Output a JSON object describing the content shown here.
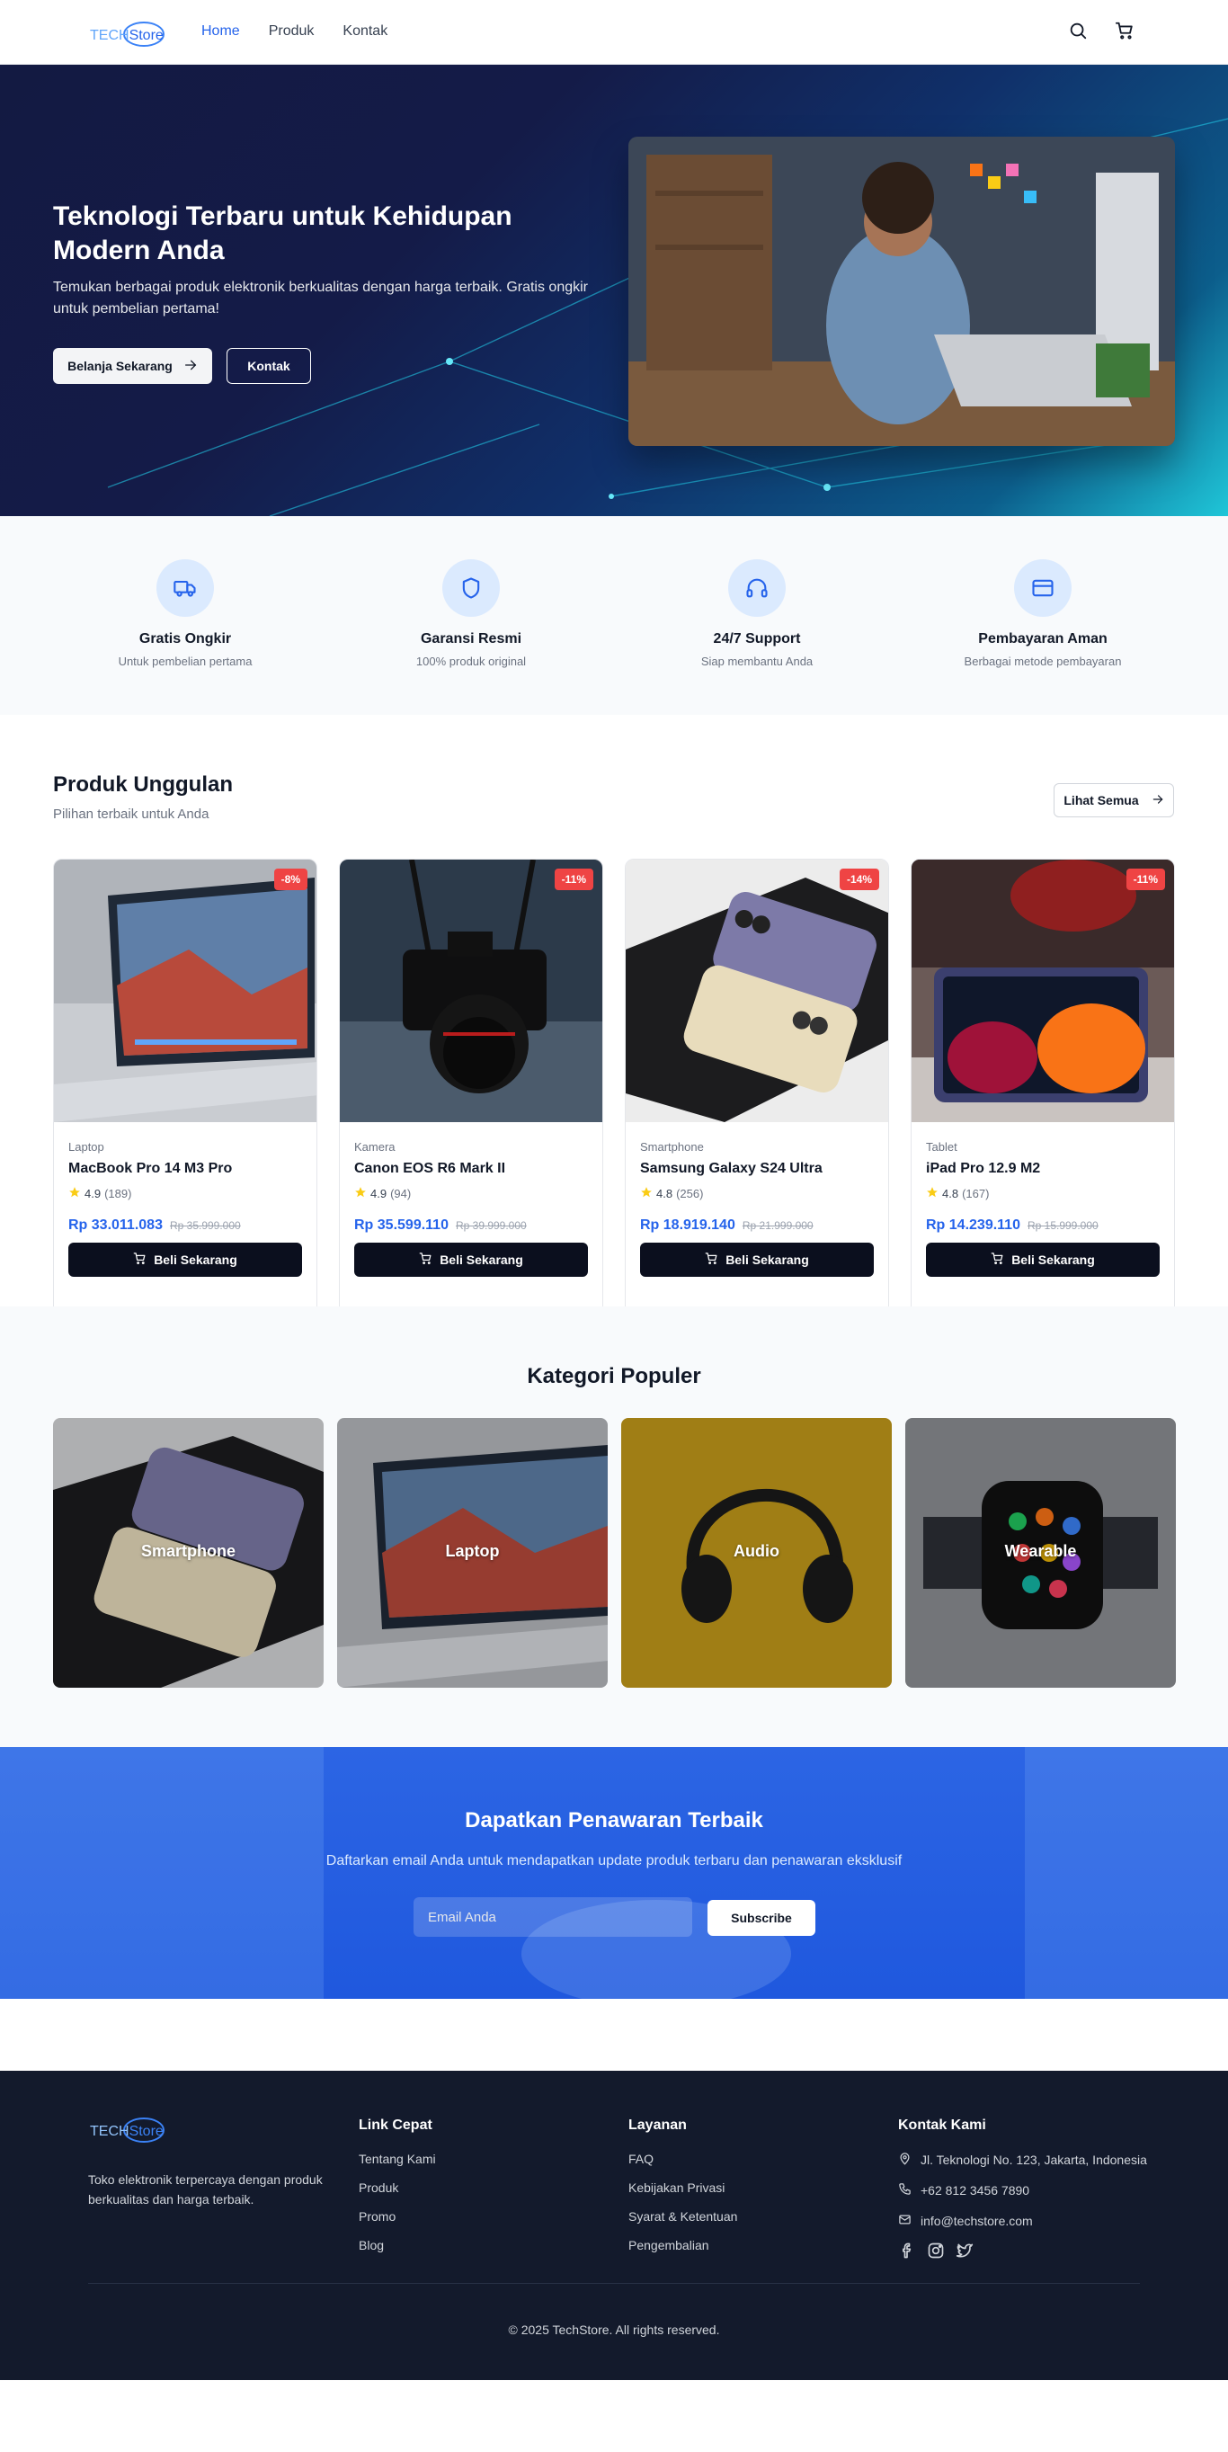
{
  "brand": {
    "name_part1": "TECH",
    "name_part2": "Store"
  },
  "nav": {
    "links": [
      "Home",
      "Produk",
      "Kontak"
    ],
    "icons": [
      "search-icon",
      "cart-icon"
    ]
  },
  "hero": {
    "title": "Teknologi Terbaru untuk Kehidupan Modern Anda",
    "subtitle": "Temukan berbagai produk elektronik berkualitas dengan harga terbaik. Gratis ongkir untuk pembelian pertama!",
    "primary_button": "Belanja Sekarang",
    "secondary_button": "Kontak"
  },
  "features": [
    {
      "icon": "truck-icon",
      "title": "Gratis Ongkir",
      "subtitle": "Untuk pembelian pertama"
    },
    {
      "icon": "shield-icon",
      "title": "Garansi Resmi",
      "subtitle": "100% produk original"
    },
    {
      "icon": "headphones-icon",
      "title": "24/7 Support",
      "subtitle": "Siap membantu Anda"
    },
    {
      "icon": "credit-card-icon",
      "title": "Pembayaran Aman",
      "subtitle": "Berbagai metode pembayaran"
    }
  ],
  "products_section": {
    "title": "Produk Unggulan",
    "subtitle": "Pilihan terbaik untuk Anda",
    "see_all": "Lihat Semua",
    "items": [
      {
        "category": "Laptop",
        "name": "MacBook Pro 14 M3 Pro",
        "rating": "4.9",
        "reviews": "(189)",
        "price": "Rp 33.011.083",
        "old_price": "Rp 35.999.000",
        "discount": "-8%",
        "buy": "Beli Sekarang"
      },
      {
        "category": "Kamera",
        "name": "Canon EOS R6 Mark II",
        "rating": "4.9",
        "reviews": "(94)",
        "price": "Rp 35.599.110",
        "old_price": "Rp 39.999.000",
        "discount": "-11%",
        "buy": "Beli Sekarang"
      },
      {
        "category": "Smartphone",
        "name": "Samsung Galaxy S24 Ultra",
        "rating": "4.8",
        "reviews": "(256)",
        "price": "Rp 18.919.140",
        "old_price": "Rp 21.999.000",
        "discount": "-14%",
        "buy": "Beli Sekarang"
      },
      {
        "category": "Tablet",
        "name": "iPad Pro 12.9 M2",
        "rating": "4.8",
        "reviews": "(167)",
        "price": "Rp 14.239.110",
        "old_price": "Rp 15.999.000",
        "discount": "-11%",
        "buy": "Beli Sekarang"
      }
    ]
  },
  "categories": {
    "title": "Kategori Populer",
    "items": [
      "Smartphone",
      "Laptop",
      "Audio",
      "Wearable"
    ]
  },
  "newsletter": {
    "title": "Dapatkan Penawaran Terbaik",
    "subtitle": "Daftarkan email Anda untuk mendapatkan update produk terbaru dan penawaran eksklusif",
    "placeholder": "Email Anda",
    "button": "Subscribe"
  },
  "footer": {
    "about": "Toko elektronik terpercaya dengan produk berkualitas dan harga terbaik.",
    "quick_links": {
      "title": "Link Cepat",
      "items": [
        "Tentang Kami",
        "Produk",
        "Promo",
        "Blog"
      ]
    },
    "services": {
      "title": "Layanan",
      "items": [
        "FAQ",
        "Kebijakan Privasi",
        "Syarat & Ketentuan",
        "Pengembalian"
      ]
    },
    "contact": {
      "title": "Kontak Kami",
      "address": "Jl. Teknologi No. 123, Jakarta, Indonesia",
      "phone": "+62 812 3456 7890",
      "email": "info@techstore.com"
    },
    "social_icons": [
      "facebook-icon",
      "instagram-icon",
      "twitter-icon"
    ],
    "copyright": "© 2025 TechStore. All rights reserved."
  },
  "colors": {
    "accent": "#2563eb",
    "discount": "#ef4444",
    "footer_bg": "#131a2c",
    "newsletter_bg": "#1f58de"
  }
}
